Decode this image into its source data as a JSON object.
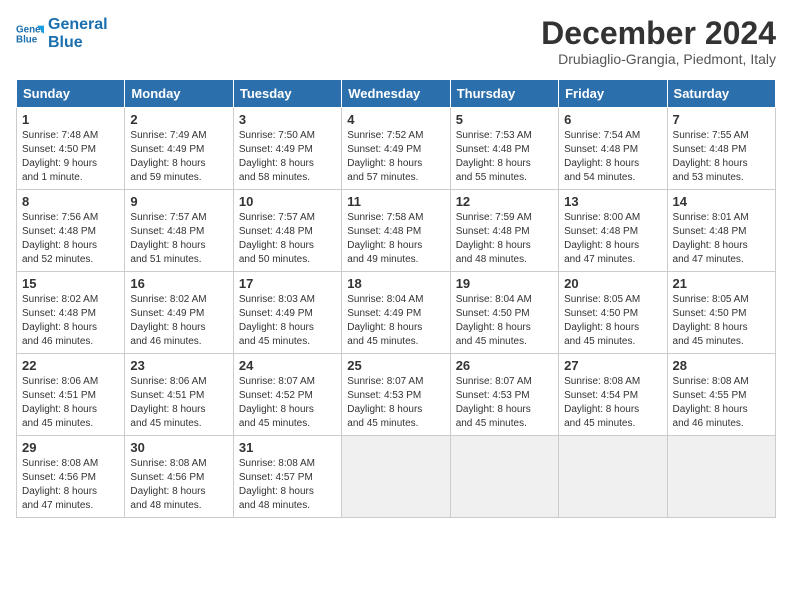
{
  "logo": {
    "line1": "General",
    "line2": "Blue"
  },
  "title": "December 2024",
  "subtitle": "Drubiaglio-Grangia, Piedmont, Italy",
  "days_of_week": [
    "Sunday",
    "Monday",
    "Tuesday",
    "Wednesday",
    "Thursday",
    "Friday",
    "Saturday"
  ],
  "weeks": [
    [
      {
        "day": "1",
        "content": "Sunrise: 7:48 AM\nSunset: 4:50 PM\nDaylight: 9 hours\nand 1 minute."
      },
      {
        "day": "2",
        "content": "Sunrise: 7:49 AM\nSunset: 4:49 PM\nDaylight: 8 hours\nand 59 minutes."
      },
      {
        "day": "3",
        "content": "Sunrise: 7:50 AM\nSunset: 4:49 PM\nDaylight: 8 hours\nand 58 minutes."
      },
      {
        "day": "4",
        "content": "Sunrise: 7:52 AM\nSunset: 4:49 PM\nDaylight: 8 hours\nand 57 minutes."
      },
      {
        "day": "5",
        "content": "Sunrise: 7:53 AM\nSunset: 4:48 PM\nDaylight: 8 hours\nand 55 minutes."
      },
      {
        "day": "6",
        "content": "Sunrise: 7:54 AM\nSunset: 4:48 PM\nDaylight: 8 hours\nand 54 minutes."
      },
      {
        "day": "7",
        "content": "Sunrise: 7:55 AM\nSunset: 4:48 PM\nDaylight: 8 hours\nand 53 minutes."
      }
    ],
    [
      {
        "day": "8",
        "content": "Sunrise: 7:56 AM\nSunset: 4:48 PM\nDaylight: 8 hours\nand 52 minutes."
      },
      {
        "day": "9",
        "content": "Sunrise: 7:57 AM\nSunset: 4:48 PM\nDaylight: 8 hours\nand 51 minutes."
      },
      {
        "day": "10",
        "content": "Sunrise: 7:57 AM\nSunset: 4:48 PM\nDaylight: 8 hours\nand 50 minutes."
      },
      {
        "day": "11",
        "content": "Sunrise: 7:58 AM\nSunset: 4:48 PM\nDaylight: 8 hours\nand 49 minutes."
      },
      {
        "day": "12",
        "content": "Sunrise: 7:59 AM\nSunset: 4:48 PM\nDaylight: 8 hours\nand 48 minutes."
      },
      {
        "day": "13",
        "content": "Sunrise: 8:00 AM\nSunset: 4:48 PM\nDaylight: 8 hours\nand 47 minutes."
      },
      {
        "day": "14",
        "content": "Sunrise: 8:01 AM\nSunset: 4:48 PM\nDaylight: 8 hours\nand 47 minutes."
      }
    ],
    [
      {
        "day": "15",
        "content": "Sunrise: 8:02 AM\nSunset: 4:48 PM\nDaylight: 8 hours\nand 46 minutes."
      },
      {
        "day": "16",
        "content": "Sunrise: 8:02 AM\nSunset: 4:49 PM\nDaylight: 8 hours\nand 46 minutes."
      },
      {
        "day": "17",
        "content": "Sunrise: 8:03 AM\nSunset: 4:49 PM\nDaylight: 8 hours\nand 45 minutes."
      },
      {
        "day": "18",
        "content": "Sunrise: 8:04 AM\nSunset: 4:49 PM\nDaylight: 8 hours\nand 45 minutes."
      },
      {
        "day": "19",
        "content": "Sunrise: 8:04 AM\nSunset: 4:50 PM\nDaylight: 8 hours\nand 45 minutes."
      },
      {
        "day": "20",
        "content": "Sunrise: 8:05 AM\nSunset: 4:50 PM\nDaylight: 8 hours\nand 45 minutes."
      },
      {
        "day": "21",
        "content": "Sunrise: 8:05 AM\nSunset: 4:50 PM\nDaylight: 8 hours\nand 45 minutes."
      }
    ],
    [
      {
        "day": "22",
        "content": "Sunrise: 8:06 AM\nSunset: 4:51 PM\nDaylight: 8 hours\nand 45 minutes."
      },
      {
        "day": "23",
        "content": "Sunrise: 8:06 AM\nSunset: 4:51 PM\nDaylight: 8 hours\nand 45 minutes."
      },
      {
        "day": "24",
        "content": "Sunrise: 8:07 AM\nSunset: 4:52 PM\nDaylight: 8 hours\nand 45 minutes."
      },
      {
        "day": "25",
        "content": "Sunrise: 8:07 AM\nSunset: 4:53 PM\nDaylight: 8 hours\nand 45 minutes."
      },
      {
        "day": "26",
        "content": "Sunrise: 8:07 AM\nSunset: 4:53 PM\nDaylight: 8 hours\nand 45 minutes."
      },
      {
        "day": "27",
        "content": "Sunrise: 8:08 AM\nSunset: 4:54 PM\nDaylight: 8 hours\nand 45 minutes."
      },
      {
        "day": "28",
        "content": "Sunrise: 8:08 AM\nSunset: 4:55 PM\nDaylight: 8 hours\nand 46 minutes."
      }
    ],
    [
      {
        "day": "29",
        "content": "Sunrise: 8:08 AM\nSunset: 4:56 PM\nDaylight: 8 hours\nand 47 minutes."
      },
      {
        "day": "30",
        "content": "Sunrise: 8:08 AM\nSunset: 4:56 PM\nDaylight: 8 hours\nand 48 minutes."
      },
      {
        "day": "31",
        "content": "Sunrise: 8:08 AM\nSunset: 4:57 PM\nDaylight: 8 hours\nand 48 minutes."
      },
      {
        "day": "",
        "content": ""
      },
      {
        "day": "",
        "content": ""
      },
      {
        "day": "",
        "content": ""
      },
      {
        "day": "",
        "content": ""
      }
    ]
  ]
}
